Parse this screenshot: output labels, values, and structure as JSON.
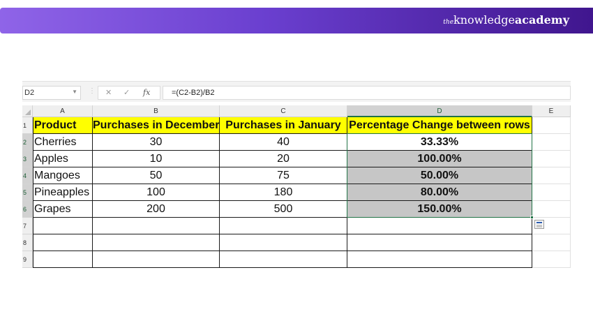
{
  "brand": {
    "the": "the",
    "knowledge": "knowledge",
    "academy": "academy"
  },
  "formula_bar": {
    "name_box": "D2",
    "cancel_icon": "✕",
    "enter_icon": "✓",
    "fx_label": "fx",
    "formula": "=(C2-B2)/B2"
  },
  "columns": [
    "A",
    "B",
    "C",
    "D",
    "E"
  ],
  "row_numbers": [
    "1",
    "2",
    "3",
    "4",
    "5",
    "6",
    "7",
    "8",
    "9"
  ],
  "headers": [
    "Product",
    "Purchases in December",
    "Purchases in January",
    "Percentage Change between rows"
  ],
  "rows": [
    {
      "product": "Cherries",
      "december": "30",
      "january": "40",
      "change": "33.33%"
    },
    {
      "product": "Apples",
      "december": "10",
      "january": "20",
      "change": "100.00%"
    },
    {
      "product": "Mangoes",
      "december": "50",
      "january": "75",
      "change": "50.00%"
    },
    {
      "product": "Pineapples",
      "december": "100",
      "january": "180",
      "change": "80.00%"
    },
    {
      "product": "Grapes",
      "december": "200",
      "january": "500",
      "change": "150.00%"
    }
  ],
  "colors": {
    "banner_start": "#8f64e8",
    "banner_end": "#40168e",
    "header_fill": "#ffff00",
    "selection_fill": "#c6c6c6",
    "selection_border": "#217346"
  }
}
